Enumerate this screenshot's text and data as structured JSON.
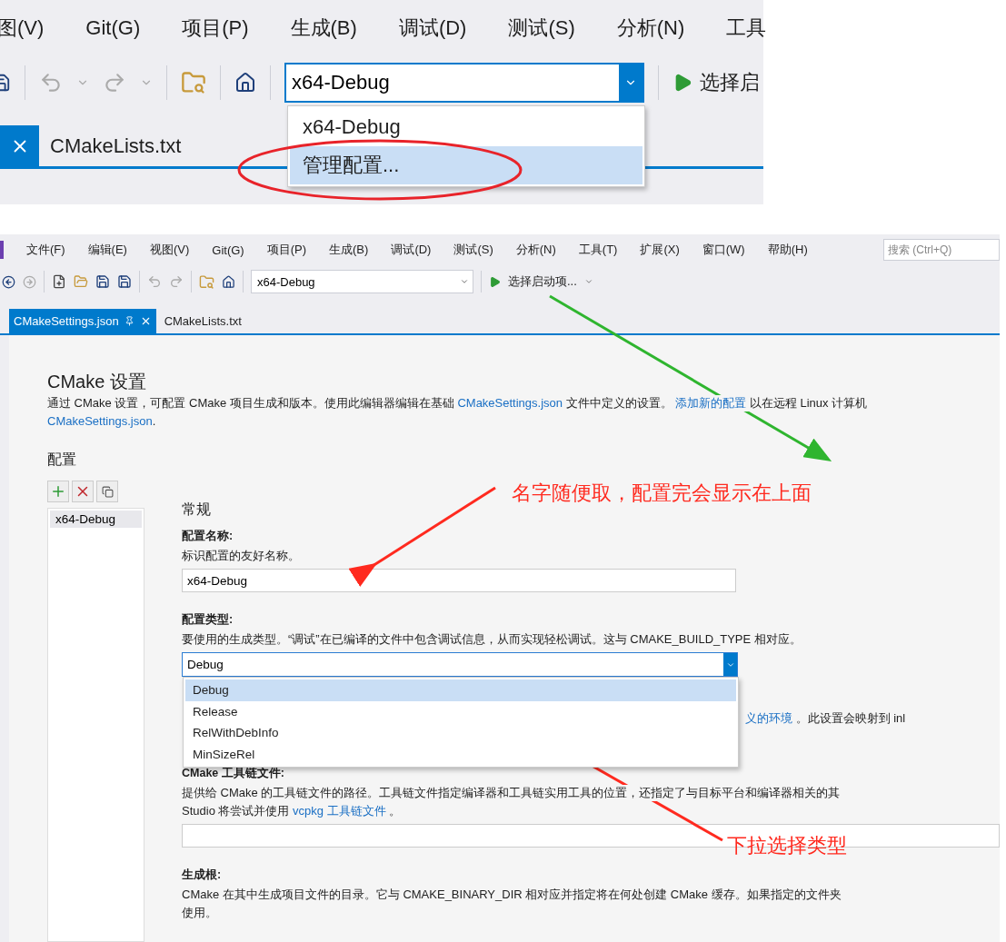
{
  "top_snippet": {
    "menu": [
      "图(V)",
      "Git(G)",
      "项目(P)",
      "生成(B)",
      "调试(D)",
      "测试(S)",
      "分析(N)",
      "工具"
    ],
    "config_combo": {
      "value": "x64-Debug"
    },
    "run_button": {
      "label": "选择启"
    },
    "tab": {
      "label": "CMakeLists.txt"
    },
    "dropdown": [
      {
        "label": "x64-Debug",
        "selected": false
      },
      {
        "label": "管理配置...",
        "selected": true
      }
    ]
  },
  "main_window": {
    "menu": [
      "文件(F)",
      "编辑(E)",
      "视图(V)",
      "Git(G)",
      "项目(P)",
      "生成(B)",
      "调试(D)",
      "测试(S)",
      "分析(N)",
      "工具(T)",
      "扩展(X)",
      "窗口(W)",
      "帮助(H)"
    ],
    "search": {
      "placeholder": "搜索 (Ctrl+Q)"
    },
    "config_combo": {
      "value": "x64-Debug"
    },
    "run_button": {
      "label": "选择启动项..."
    },
    "tabs": [
      {
        "label": "CMakeSettings.json",
        "selected": true
      },
      {
        "label": "CMakeLists.txt",
        "selected": false
      }
    ],
    "page": {
      "title": "CMake 设置",
      "description": [
        [
          {
            "kind": "text",
            "text": "通过 CMake 设置，可配置 CMake 项目生成和版本。使用此编辑器编辑在基础 "
          },
          {
            "kind": "link",
            "text": "CMakeSettings.json"
          },
          {
            "kind": "text",
            "text": " 文件中定义的设置。 "
          },
          {
            "kind": "link",
            "text": "添加新的配置"
          },
          {
            "kind": "text",
            "text": " 以在远程 Linux 计算机"
          }
        ],
        [
          {
            "kind": "link",
            "text": "CMakeSettings.json"
          },
          {
            "kind": "text",
            "text": "."
          }
        ]
      ],
      "configs_heading": "配置",
      "configs": [
        {
          "label": "x64-Debug",
          "selected": true
        }
      ],
      "section_heading": "常规",
      "fields": [
        {
          "kind": "text",
          "label": "配置名称:",
          "help": [
            [
              {
                "kind": "text",
                "text": "标识配置的友好名称。"
              }
            ]
          ],
          "value": "x64-Debug"
        },
        {
          "kind": "select",
          "label": "配置类型:",
          "help": [
            [
              {
                "kind": "text",
                "text": "要使用的生成类型。“调试”在已编译的文件中包含调试信息，从而实现轻松调试。这与 CMAKE_BUILD_TYPE 相对应。"
              }
            ]
          ],
          "value": "Debug",
          "options": [
            {
              "label": "Debug",
              "selected": true
            },
            {
              "label": "Release",
              "selected": false
            },
            {
              "label": "RelWithDebInfo",
              "selected": false
            },
            {
              "label": "MinSizeRel",
              "selected": false
            }
          ],
          "behind": [
            {
              "kind": "link",
              "text": "义的环境"
            },
            {
              "kind": "text",
              "text": " 。此设置会映射到 inl"
            }
          ]
        },
        {
          "kind": "text",
          "label": "CMake 工具链文件:",
          "help": [
            [
              {
                "kind": "text",
                "text": "提供给 CMake 的工具链文件的路径。工具链文件指定编译器和工具链实用工具的位置，还指定了与目标平台和编译器相关的其"
              }
            ],
            [
              {
                "kind": "text",
                "text": "Studio 将尝试并使用 "
              },
              {
                "kind": "link",
                "text": "vcpkg 工具链文件"
              },
              {
                "kind": "text",
                "text": " 。"
              }
            ]
          ]
        },
        {
          "kind": "none",
          "label": "生成根:",
          "help": [
            [
              {
                "kind": "text",
                "text": "CMake 在其中生成项目文件的目录。它与 CMAKE_BINARY_DIR 相对应并指定将在何处创建 CMake 缓存。如果指定的文件夹"
              }
            ],
            [
              {
                "kind": "text",
                "text": "使用。"
              }
            ]
          ]
        }
      ]
    }
  },
  "annotations": [
    {
      "text": "名字随便取，配置完会显示在上面"
    },
    {
      "text": "下拉选择类型"
    }
  ]
}
